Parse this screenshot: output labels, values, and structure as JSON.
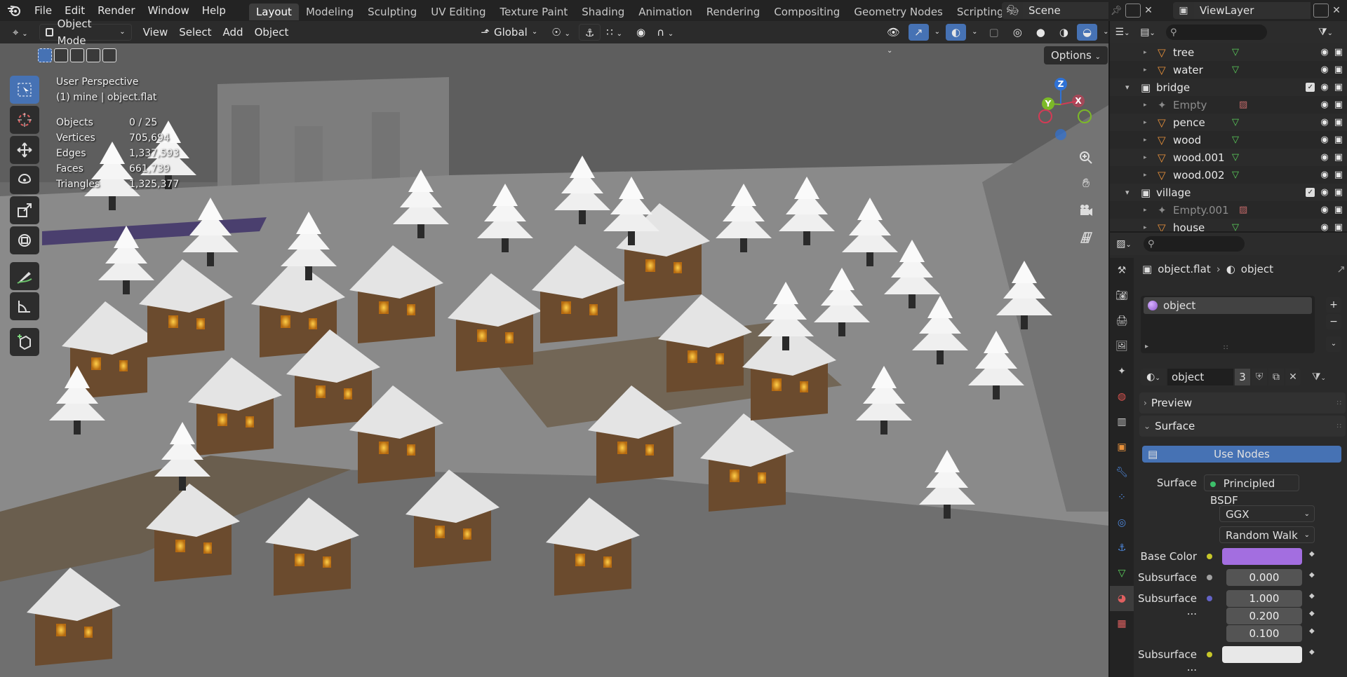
{
  "menu": {
    "items": [
      "File",
      "Edit",
      "Render",
      "Window",
      "Help"
    ]
  },
  "workspaces": {
    "tabs": [
      "Layout",
      "Modeling",
      "Sculpting",
      "UV Editing",
      "Texture Paint",
      "Shading",
      "Animation",
      "Rendering",
      "Compositing",
      "Geometry Nodes",
      "Scripting"
    ],
    "active": "Layout"
  },
  "scene": {
    "name": "Scene"
  },
  "view_layer": {
    "name": "ViewLayer"
  },
  "viewport_header": {
    "mode": "Object Mode",
    "menus": [
      "View",
      "Select",
      "Add",
      "Object"
    ],
    "transform_orientation": "Global",
    "options_label": "Options"
  },
  "viewport_overlay": {
    "perspective": "User Perspective",
    "collection_line": "(1) mine | object.flat",
    "stats": [
      {
        "label": "Objects",
        "value": "0 / 25"
      },
      {
        "label": "Vertices",
        "value": "705,694"
      },
      {
        "label": "Edges",
        "value": "1,337,593"
      },
      {
        "label": "Faces",
        "value": "661,739"
      },
      {
        "label": "Triangles",
        "value": "1,325,377"
      }
    ]
  },
  "gizmo": {
    "x": "X",
    "y": "Y",
    "z": "Z"
  },
  "outliner": {
    "rows": [
      {
        "name": "tree",
        "type": "object",
        "indent": 2
      },
      {
        "name": "water",
        "type": "object",
        "indent": 2
      },
      {
        "name": "bridge",
        "type": "collection",
        "indent": 1
      },
      {
        "name": "Empty",
        "type": "empty",
        "indent": 2
      },
      {
        "name": "pence",
        "type": "object",
        "indent": 2
      },
      {
        "name": "wood",
        "type": "object",
        "indent": 2
      },
      {
        "name": "wood.001",
        "type": "object",
        "indent": 2
      },
      {
        "name": "wood.002",
        "type": "object",
        "indent": 2
      },
      {
        "name": "village",
        "type": "collection",
        "indent": 1
      },
      {
        "name": "Empty.001",
        "type": "empty",
        "indent": 2
      },
      {
        "name": "house",
        "type": "object",
        "indent": 2
      }
    ]
  },
  "properties": {
    "breadcrumb": {
      "object": "object.flat",
      "material": "object"
    },
    "material_slot": "object",
    "material_name": "object",
    "user_count": "3",
    "panels": {
      "preview": "Preview",
      "surface": "Surface"
    },
    "use_nodes": "Use Nodes",
    "surface_label": "Surface",
    "surface_value": "Principled BSDF",
    "distribution": "GGX",
    "subsurface_method": "Random Walk",
    "fields": [
      {
        "label": "Base Color",
        "value": "",
        "kind": "color",
        "color": "#a36ee0"
      },
      {
        "label": "Subsurface",
        "value": "0.000",
        "kind": "number"
      },
      {
        "label": "Subsurface ...",
        "value": "1.000",
        "kind": "number"
      },
      {
        "label": "",
        "value": "0.200",
        "kind": "number"
      },
      {
        "label": "",
        "value": "0.100",
        "kind": "number"
      },
      {
        "label": "Subsurface ...",
        "value": "",
        "kind": "color",
        "color": "#e8e8e8"
      }
    ]
  },
  "colors": {
    "accent": "#4672b4",
    "header_bg": "#232323",
    "base_color": "#a36ee0",
    "object_icon": "#e8913b",
    "mesh_icon": "#5bd15b"
  }
}
